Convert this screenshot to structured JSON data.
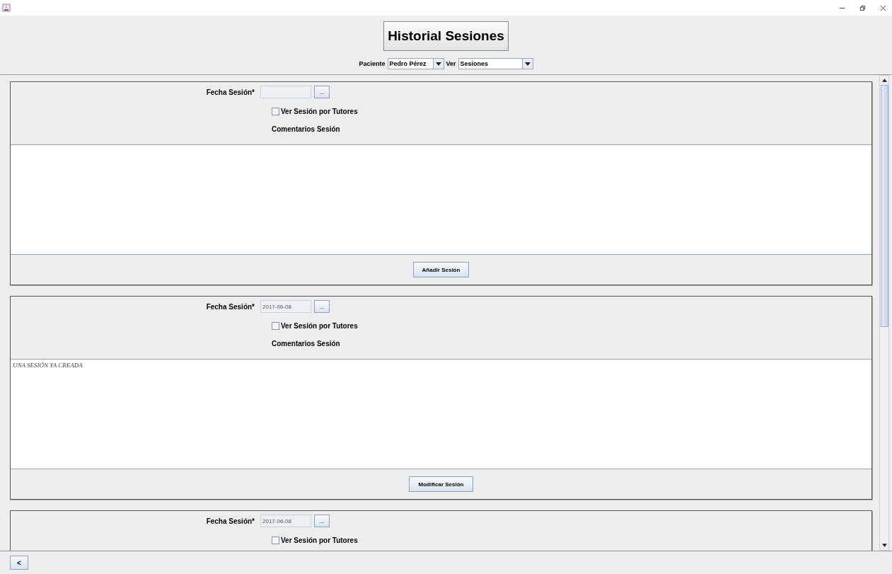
{
  "header": {
    "title": "Historial Sesiones",
    "patient_label": "Paciente",
    "patient": "Pedro Pérez",
    "view_label": "Ver",
    "view": "Sesiones"
  },
  "sessions": [
    {
      "date_label": "Fecha Sesión*",
      "picker": "...",
      "tutors_label": "Ver Sesión por Tutores",
      "tutors_checked": false,
      "comments_label": "Comentarios Sesión",
      "button": "Añadir Sesión"
    },
    {
      "date_label": "Fecha Sesión*",
      "date": "2017-06-08",
      "picker": "...",
      "tutors_label": "Ver Sesión por Tutores",
      "tutors_checked": false,
      "comments_label": "Comentarios Sesión",
      "comments": "UNA SESIÓN YA CREADA",
      "button": "Modificar Sesión"
    },
    {
      "date_label": "Fecha Sesión*",
      "date": "2017-06-08",
      "picker": "...",
      "tutors_label": "Ver Sesión por Tutores",
      "tutors_checked": false
    }
  ],
  "back_button": "<"
}
